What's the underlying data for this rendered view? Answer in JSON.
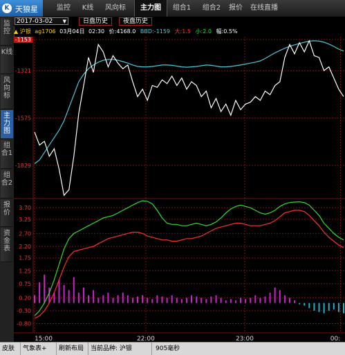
{
  "app": {
    "name": "天狼星"
  },
  "tabs": [
    {
      "label": "监控"
    },
    {
      "label": "K线"
    },
    {
      "label": "风向标"
    },
    {
      "label": "主力图"
    },
    {
      "label": "组合1"
    },
    {
      "label": "组合2"
    },
    {
      "label": "报价"
    },
    {
      "label": "在线直播"
    }
  ],
  "side_tabs": [
    {
      "label": "监控"
    },
    {
      "label": "K线"
    },
    {
      "label": "风向标"
    },
    {
      "label": "主力图"
    },
    {
      "label": "组合1"
    },
    {
      "label": "组合2"
    },
    {
      "label": "报价"
    },
    {
      "label": "资金表"
    }
  ],
  "toolbar": {
    "date": "2017-03-02",
    "day_history": "日盘历史",
    "night_history": "夜盘历史"
  },
  "info": {
    "symbol": "沪银",
    "contract": "ag1706",
    "date": "03月04日",
    "time": "02:30",
    "price_label": "价:",
    "price": "4168.0",
    "bbd_label": "BBD:",
    "bbd": "-1159",
    "big_label": "大:",
    "big": "1.5",
    "small_label": "小:",
    "small": "2.0",
    "amp_label": "幅:",
    "amp": "0.5%"
  },
  "colors": {
    "price": "#ffffff",
    "avg": "#4fc8dc",
    "green": "#2ee02e",
    "red": "#ff3030",
    "bars_pos": "#d020d0",
    "bars_neg": "#20b0c8",
    "grid": "#7a1010"
  },
  "chart_data": {
    "type": "line",
    "upper": {
      "yticks": [
        "-1153",
        "-1321",
        "-1575",
        "-1829"
      ],
      "current": "-1153",
      "price": [
        -1650,
        -1720,
        -1700,
        -1780,
        -1740,
        -1850,
        -1990,
        -1960,
        -1780,
        -1550,
        -1400,
        -1250,
        -1330,
        -1180,
        -1220,
        -1300,
        -1240,
        -1280,
        -1310,
        -1290,
        -1380,
        -1460,
        -1420,
        -1480,
        -1400,
        -1410,
        -1370,
        -1390,
        -1350,
        -1400,
        -1360,
        -1420,
        -1380,
        -1400,
        -1460,
        -1430,
        -1520,
        -1470,
        -1540,
        -1500,
        -1560,
        -1480,
        -1530,
        -1500,
        -1490,
        -1460,
        -1480,
        -1430,
        -1450,
        -1400,
        -1380,
        -1250,
        -1180,
        -1230,
        -1170,
        -1220,
        -1160,
        -1240,
        -1250,
        -1320,
        -1300,
        -1360,
        -1420,
        -1460
      ],
      "avg": [
        -1820,
        -1800,
        -1760,
        -1720,
        -1680,
        -1640,
        -1590,
        -1520,
        -1450,
        -1380,
        -1340,
        -1310,
        -1290,
        -1275,
        -1265,
        -1260,
        -1260,
        -1265,
        -1272,
        -1280,
        -1290,
        -1298,
        -1300,
        -1300,
        -1298,
        -1294,
        -1290,
        -1290,
        -1292,
        -1296,
        -1300,
        -1302,
        -1300,
        -1298,
        -1294,
        -1290,
        -1292,
        -1296,
        -1300,
        -1300,
        -1298,
        -1294,
        -1290,
        -1285,
        -1280,
        -1275,
        -1268,
        -1255,
        -1240,
        -1225,
        -1212,
        -1200,
        -1190,
        -1182,
        -1175,
        -1168,
        -1162,
        -1160,
        -1162,
        -1168,
        -1178,
        -1190,
        -1205,
        -1215
      ]
    },
    "lower": {
      "yticks": [
        "3.70",
        "3.25",
        "2.70",
        "2.20",
        "1.75",
        "1.25",
        "0.75",
        "0.20",
        "-0.30",
        "-0.80"
      ],
      "green": [
        -0.5,
        -0.3,
        0.0,
        0.4,
        0.9,
        1.5,
        2.1,
        2.5,
        2.7,
        2.8,
        2.9,
        3.0,
        3.1,
        3.2,
        3.3,
        3.35,
        3.4,
        3.5,
        3.6,
        3.7,
        3.8,
        3.9,
        3.97,
        3.95,
        3.85,
        3.6,
        3.3,
        3.1,
        3.05,
        3.05,
        3.0,
        3.0,
        3.05,
        3.1,
        3.05,
        3.0,
        3.05,
        3.15,
        3.3,
        3.5,
        3.65,
        3.75,
        3.8,
        3.75,
        3.7,
        3.6,
        3.5,
        3.45,
        3.5,
        3.6,
        3.75,
        3.85,
        3.9,
        3.92,
        3.93,
        3.9,
        3.8,
        3.6,
        3.4,
        3.1,
        2.9,
        2.7,
        2.55,
        2.45
      ],
      "red": [
        -0.6,
        -0.5,
        -0.3,
        0.0,
        0.4,
        0.9,
        1.4,
        1.8,
        2.0,
        2.05,
        2.1,
        2.15,
        2.2,
        2.3,
        2.4,
        2.5,
        2.55,
        2.6,
        2.65,
        2.7,
        2.75,
        2.75,
        2.7,
        2.6,
        2.55,
        2.5,
        2.45,
        2.45,
        2.4,
        2.4,
        2.45,
        2.5,
        2.5,
        2.55,
        2.6,
        2.7,
        2.8,
        2.9,
        2.95,
        3.0,
        3.05,
        3.1,
        3.1,
        3.05,
        3.0,
        3.0,
        3.0,
        3.05,
        3.1,
        3.2,
        3.35,
        3.5,
        3.55,
        3.6,
        3.6,
        3.55,
        3.4,
        3.2,
        3.0,
        2.75,
        2.55,
        2.4,
        2.25,
        2.15
      ],
      "bars": [
        0.3,
        0.8,
        1.1,
        0.6,
        0.4,
        0.9,
        0.7,
        0.5,
        1.0,
        0.4,
        0.6,
        0.3,
        0.5,
        0.2,
        0.3,
        0.4,
        0.2,
        0.3,
        0.4,
        0.3,
        0.2,
        0.25,
        0.3,
        0.2,
        0.15,
        0.3,
        0.25,
        0.2,
        0.3,
        0.2,
        0.15,
        0.2,
        0.3,
        0.25,
        0.2,
        0.15,
        0.25,
        0.3,
        0.2,
        0.1,
        0.15,
        0.1,
        0.2,
        0.15,
        0.2,
        0.3,
        0.2,
        0.25,
        0.4,
        0.6,
        0.5,
        0.3,
        0.2,
        0.1,
        -0.05,
        -0.1,
        -0.2,
        -0.3,
        -0.35,
        -0.4,
        -0.3,
        -0.25,
        -0.35,
        -0.4
      ]
    },
    "xticks": [
      "15:00",
      "22:00",
      "23:00",
      "00:"
    ]
  },
  "status": {
    "skin": "皮肤",
    "weather": "气象表+",
    "refresh": "刷新布局",
    "current_label": "当前品种:",
    "current_value": "沪银",
    "signal": "905毫秒"
  }
}
